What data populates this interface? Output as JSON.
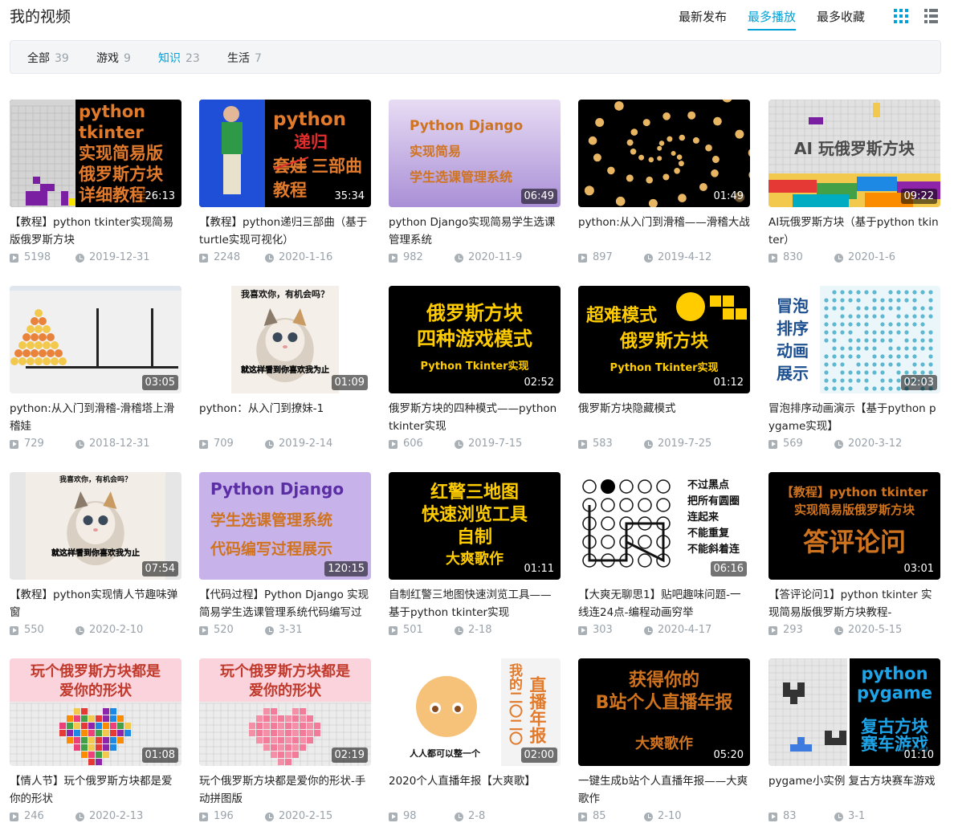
{
  "header": {
    "title": "我的视频",
    "sort": [
      {
        "label": "最新发布",
        "active": false
      },
      {
        "label": "最多播放",
        "active": true
      },
      {
        "label": "最多收藏",
        "active": false
      }
    ]
  },
  "filters": [
    {
      "label": "全部",
      "count": "39",
      "active": false
    },
    {
      "label": "游戏",
      "count": "9",
      "active": false
    },
    {
      "label": "知识",
      "count": "23",
      "active": true
    },
    {
      "label": "生活",
      "count": "7",
      "active": false
    }
  ],
  "colors": {
    "accent": "#00a1d6",
    "text": "#222222",
    "muted": "#99a2aa",
    "filter_bg": "#f4f5f7"
  },
  "videos": [
    {
      "title": "【教程】python tkinter实现简易版俄罗斯方块",
      "duration": "26:13",
      "plays": "5198",
      "date": "2019-12-31",
      "thumb_lines": [
        "python",
        "tkinter",
        "实现简易版",
        "俄罗斯方块",
        "详细教程"
      ]
    },
    {
      "title": "【教程】python递归三部曲（基于turtle实现可视化）",
      "duration": "35:34",
      "plays": "2248",
      "date": "2020-1-16",
      "thumb_lines": [
        "python",
        "递归",
        "套娃",
        "三部曲",
        "教程"
      ]
    },
    {
      "title": "python Django实现简易学生选课管理系统",
      "duration": "06:49",
      "plays": "982",
      "date": "2020-11-9",
      "thumb_lines": [
        "Python Django",
        "实现简易",
        "学生选课管理系统"
      ]
    },
    {
      "title": "python:从入门到滑稽——滑稽大战",
      "duration": "01:49",
      "plays": "897",
      "date": "2019-4-12",
      "thumb_lines": []
    },
    {
      "title": "AI玩俄罗斯方块（基于python tkinter）",
      "duration": "09:22",
      "plays": "830",
      "date": "2020-1-6",
      "thumb_lines": [
        "AI 玩俄罗斯方块"
      ]
    },
    {
      "title": "python:从入门到滑稽-滑稽塔上滑稽娃",
      "duration": "03:05",
      "plays": "729",
      "date": "2018-12-31",
      "thumb_lines": []
    },
    {
      "title": "python：从入门到撩妹-1",
      "duration": "01:09",
      "plays": "709",
      "date": "2019-2-14",
      "thumb_lines": [
        "我喜欢你，有机会吗？",
        "就这样看到你喜欢我为止"
      ]
    },
    {
      "title": "俄罗斯方块的四种模式——python tkinter实现",
      "duration": "02:52",
      "plays": "606",
      "date": "2019-7-15",
      "thumb_lines": [
        "俄罗斯方块",
        "四种游戏模式",
        "Python Tkinter实现"
      ]
    },
    {
      "title": "俄罗斯方块隐藏模式",
      "duration": "01:12",
      "plays": "583",
      "date": "2019-7-25",
      "thumb_lines": [
        "超难模式",
        "俄罗斯方块",
        "Python Tkinter实现"
      ]
    },
    {
      "title": "冒泡排序动画演示【基于python pygame实现】",
      "duration": "02:03",
      "plays": "569",
      "date": "2020-3-12",
      "thumb_lines": [
        "冒泡",
        "排序",
        "动画",
        "展示"
      ]
    },
    {
      "title": "【教程】python实现情人节趣味弹窗",
      "duration": "07:54",
      "plays": "550",
      "date": "2020-2-10",
      "thumb_lines": [
        "我喜欢你，有机会吗？",
        "就这样看到你喜欢我为止"
      ]
    },
    {
      "title": "【代码过程】Python Django 实现简易学生选课管理系统代码编写过程展示",
      "duration": "120:15",
      "plays": "520",
      "date": "3-31",
      "thumb_lines": [
        "Python Django",
        "学生选课管理系统",
        "代码编写过程展示"
      ]
    },
    {
      "title": "自制红警三地图快速浏览工具——基于python tkinter实现",
      "duration": "01:11",
      "plays": "501",
      "date": "2-18",
      "thumb_lines": [
        "红警三地图",
        "快速浏览工具",
        "自制",
        "大爽歌作"
      ]
    },
    {
      "title": "【大爽无聊思1】贴吧趣味问题-一线连24点-编程动画穷举",
      "duration": "06:16",
      "plays": "303",
      "date": "2020-4-17",
      "thumb_lines": [
        "不过黑点",
        "把所有圆圈",
        "连起来",
        "不能重复",
        "不能斜着连"
      ]
    },
    {
      "title": "【答评论问1】python tkinter 实现简易版俄罗斯方块教程-",
      "duration": "03:01",
      "plays": "293",
      "date": "2020-5-15",
      "thumb_lines": [
        "【教程】python tkinter",
        "实现简易版俄罗斯方块",
        "答评论问"
      ]
    },
    {
      "title": "【情人节】玩个俄罗斯方块都是爱你的形状",
      "duration": "01:08",
      "plays": "246",
      "date": "2020-2-13",
      "thumb_lines": [
        "玩个俄罗斯方块都是",
        "爱你的形状"
      ]
    },
    {
      "title": "玩个俄罗斯方块都是爱你的形状-手动拼图版",
      "duration": "02:19",
      "plays": "196",
      "date": "2020-2-15",
      "thumb_lines": [
        "玩个俄罗斯方块都是",
        "爱你的形状"
      ]
    },
    {
      "title": "2020个人直播年报【大爽歌】",
      "duration": "02:00",
      "plays": "98",
      "date": "2-8",
      "thumb_lines": [
        "直播年报",
        "我的二〇二〇",
        "人人都可以整一个"
      ]
    },
    {
      "title": "一键生成b站个人直播年报——大爽歌作",
      "duration": "05:20",
      "plays": "85",
      "date": "2-10",
      "thumb_lines": [
        "获得你的",
        "B站个人直播年报",
        "大爽歌作"
      ]
    },
    {
      "title": "pygame小实例 复古方块赛车游戏",
      "duration": "01:10",
      "plays": "83",
      "date": "3-1",
      "thumb_lines": [
        "python",
        "pygame",
        "复古方块",
        "赛车游戏"
      ]
    }
  ]
}
